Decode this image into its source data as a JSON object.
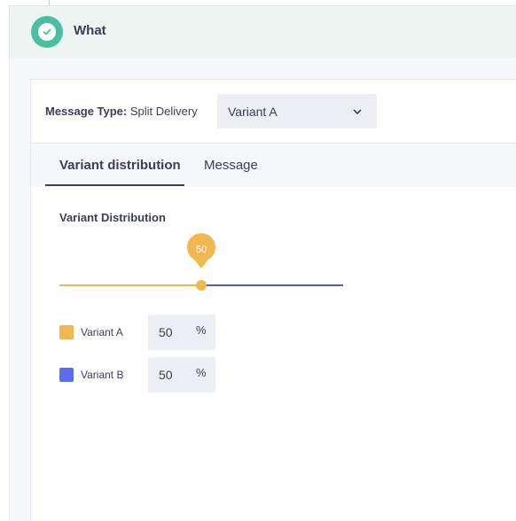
{
  "section": {
    "title": "What"
  },
  "message_type": {
    "label": "Message Type:",
    "value": "Split Delivery"
  },
  "variant_dropdown": {
    "selected": "Variant A"
  },
  "tabs": [
    {
      "label": "Variant distribution",
      "active": true
    },
    {
      "label": "Message",
      "active": false
    }
  ],
  "distribution": {
    "title": "Variant Distribution",
    "slider_value": 50,
    "slider_value_label": "50",
    "variants": [
      {
        "name": "Variant A",
        "percent": "50",
        "unit": "%",
        "color": "#f0b84f"
      },
      {
        "name": "Variant B",
        "percent": "50",
        "unit": "%",
        "color": "#5a6ff0"
      }
    ]
  },
  "colors": {
    "accent_green": "#4cbfa3",
    "slider_left": "#f0b84f",
    "slider_right": "#4b5ec9",
    "text": "#3a3f55"
  }
}
